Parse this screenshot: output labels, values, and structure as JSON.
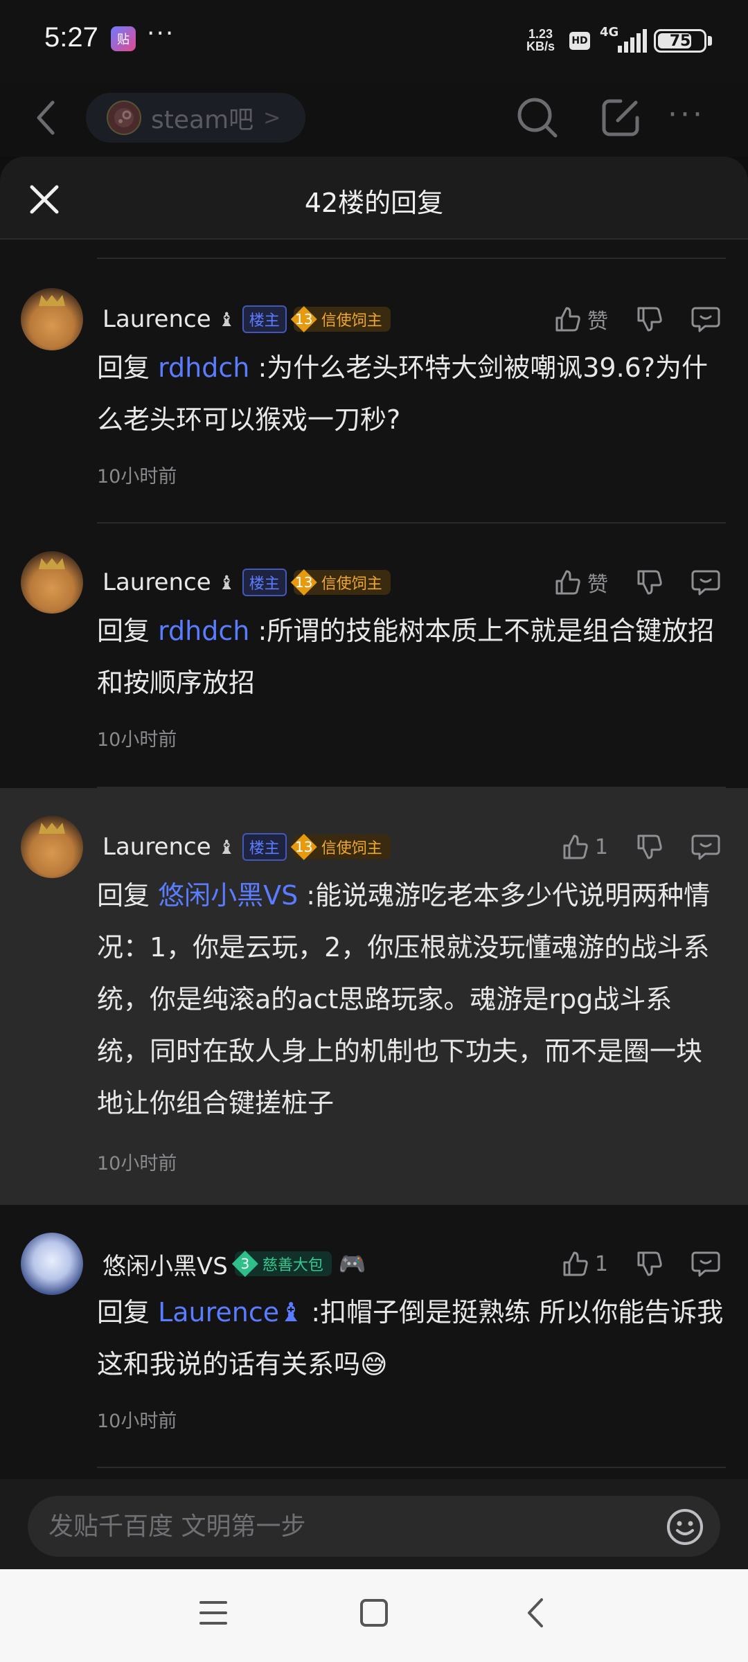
{
  "status_bar": {
    "time": "5:27",
    "app_badge": "贴",
    "more": "···",
    "speed_value": "1.23",
    "speed_unit": "KB/s",
    "hd": "HD",
    "network": "4G",
    "battery": "75",
    "battery_fraction": 0.75
  },
  "app_header": {
    "forum_name": "steam吧",
    "chevron": ">",
    "more": "···"
  },
  "sheet": {
    "title": "42楼的回复"
  },
  "replies": [
    {
      "user": "Laurence",
      "user_badge": "♝",
      "op_tag": "楼主",
      "level": "13",
      "level_title": "信使饲主",
      "like_label": "赞",
      "prefix": "回复 ",
      "mention": "rdhdch",
      "text": " :为什么老头环特大剑被嘲讽39.6?为什么老头环可以猴戏一刀秒?",
      "time": "10小时前"
    },
    {
      "user": "Laurence",
      "user_badge": "♝",
      "op_tag": "楼主",
      "level": "13",
      "level_title": "信使饲主",
      "like_label": "赞",
      "prefix": "回复 ",
      "mention": "rdhdch",
      "text": " :所谓的技能树本质上不就是组合键放招和按顺序放招",
      "time": "10小时前"
    },
    {
      "user": "Laurence",
      "user_badge": "♝",
      "op_tag": "楼主",
      "level": "13",
      "level_title": "信使饲主",
      "like_label": "1",
      "prefix": "回复 ",
      "mention": "悠闲小黑VS",
      "text": " :能说魂游吃老本多少代说明两种情况：1，你是云玩，2，你压根就没玩懂魂游的战斗系统，你是纯滚a的act思路玩家。魂游是rpg战斗系统，同时在敌人身上的机制也下功夫，而不是圈一块地让你组合键搓桩子",
      "time": "10小时前"
    },
    {
      "user": "悠闲小黑VS",
      "level": "3",
      "level_title": "慈善大包",
      "extra_icon": "🎮",
      "like_label": "1",
      "prefix": "回复 ",
      "mention": "Laurence♝",
      "text": " :扣帽子倒是挺熟练 所以你能告诉我这和我说的话有关系吗😅",
      "time": "10小时前"
    }
  ],
  "input": {
    "placeholder": "发贴千百度 文明第一步"
  }
}
